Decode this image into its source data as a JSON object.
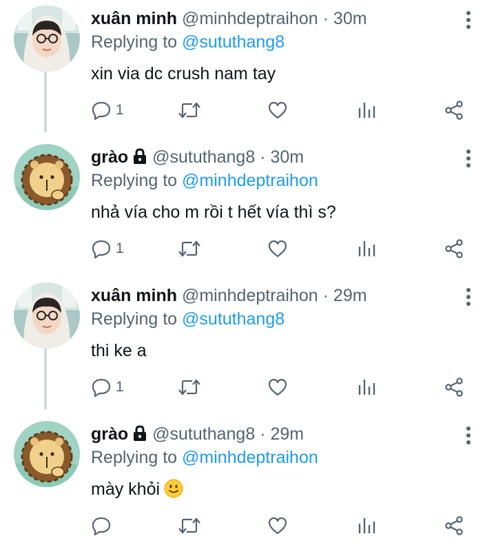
{
  "tweets": [
    {
      "avatar": "person-avatar",
      "name": "xuân minh",
      "locked": false,
      "handle": "@minhdeptraihon",
      "dot": "·",
      "time": "30m",
      "reply_prefix": "Replying to",
      "reply_to": "@sututhang8",
      "text": "xin via dc crush nam tay",
      "emoji": "",
      "reply_count": "1"
    },
    {
      "avatar": "lion-avatar",
      "name": "grào",
      "locked": true,
      "handle": "@sututhang8",
      "dot": "·",
      "time": "30m",
      "reply_prefix": "Replying to",
      "reply_to": "@minhdeptraihon",
      "text": "nhả vía cho m rồi t hết vía thì s?",
      "emoji": "",
      "reply_count": "1"
    },
    {
      "avatar": "person-avatar",
      "name": "xuân minh",
      "locked": false,
      "handle": "@minhdeptraihon",
      "dot": "·",
      "time": "29m",
      "reply_prefix": "Replying to",
      "reply_to": "@sututhang8",
      "text": "thi ke a",
      "emoji": "",
      "reply_count": "1"
    },
    {
      "avatar": "lion-avatar",
      "name": "grào",
      "locked": true,
      "handle": "@sututhang8",
      "dot": "·",
      "time": "29m",
      "reply_prefix": "Replying to",
      "reply_to": "@minhdeptraihon",
      "text": "mày khỏi",
      "emoji": "slightly-smiling-face",
      "reply_count": ""
    }
  ],
  "icons": {
    "reply": "reply-icon",
    "retweet": "retweet-icon",
    "like": "heart-icon",
    "views": "views-icon",
    "share": "share-icon",
    "more": "more-options-icon",
    "lock": "lock-icon"
  },
  "colors": {
    "text": "#0f1419",
    "secondary": "#536471",
    "mention": "#1d9bf0",
    "thread_line": "#cfd9de"
  }
}
